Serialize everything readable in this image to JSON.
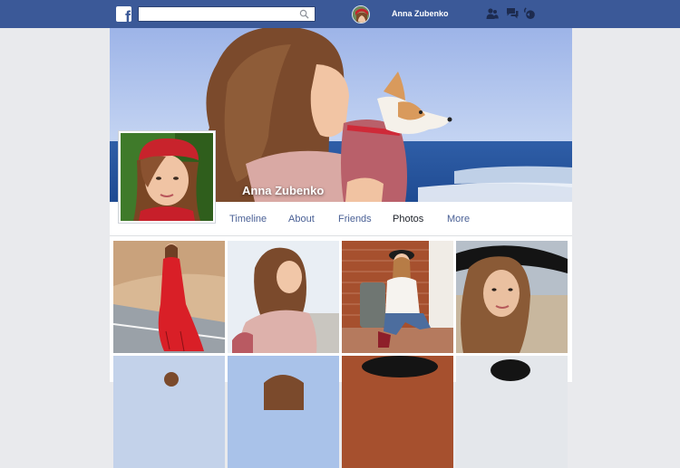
{
  "header": {
    "search_placeholder": "",
    "user_name": "Anna Zubenko",
    "icons": [
      "friend-requests-icon",
      "messages-icon",
      "notifications-icon"
    ],
    "brand_color": "#3b5998"
  },
  "profile": {
    "name": "Anna Zubenko"
  },
  "tabs": [
    {
      "label": "Timeline"
    },
    {
      "label": "About"
    },
    {
      "label": "Friends"
    },
    {
      "label": "Photos",
      "active": true
    },
    {
      "label": "More"
    }
  ],
  "photos": {
    "count_visible": 8
  }
}
